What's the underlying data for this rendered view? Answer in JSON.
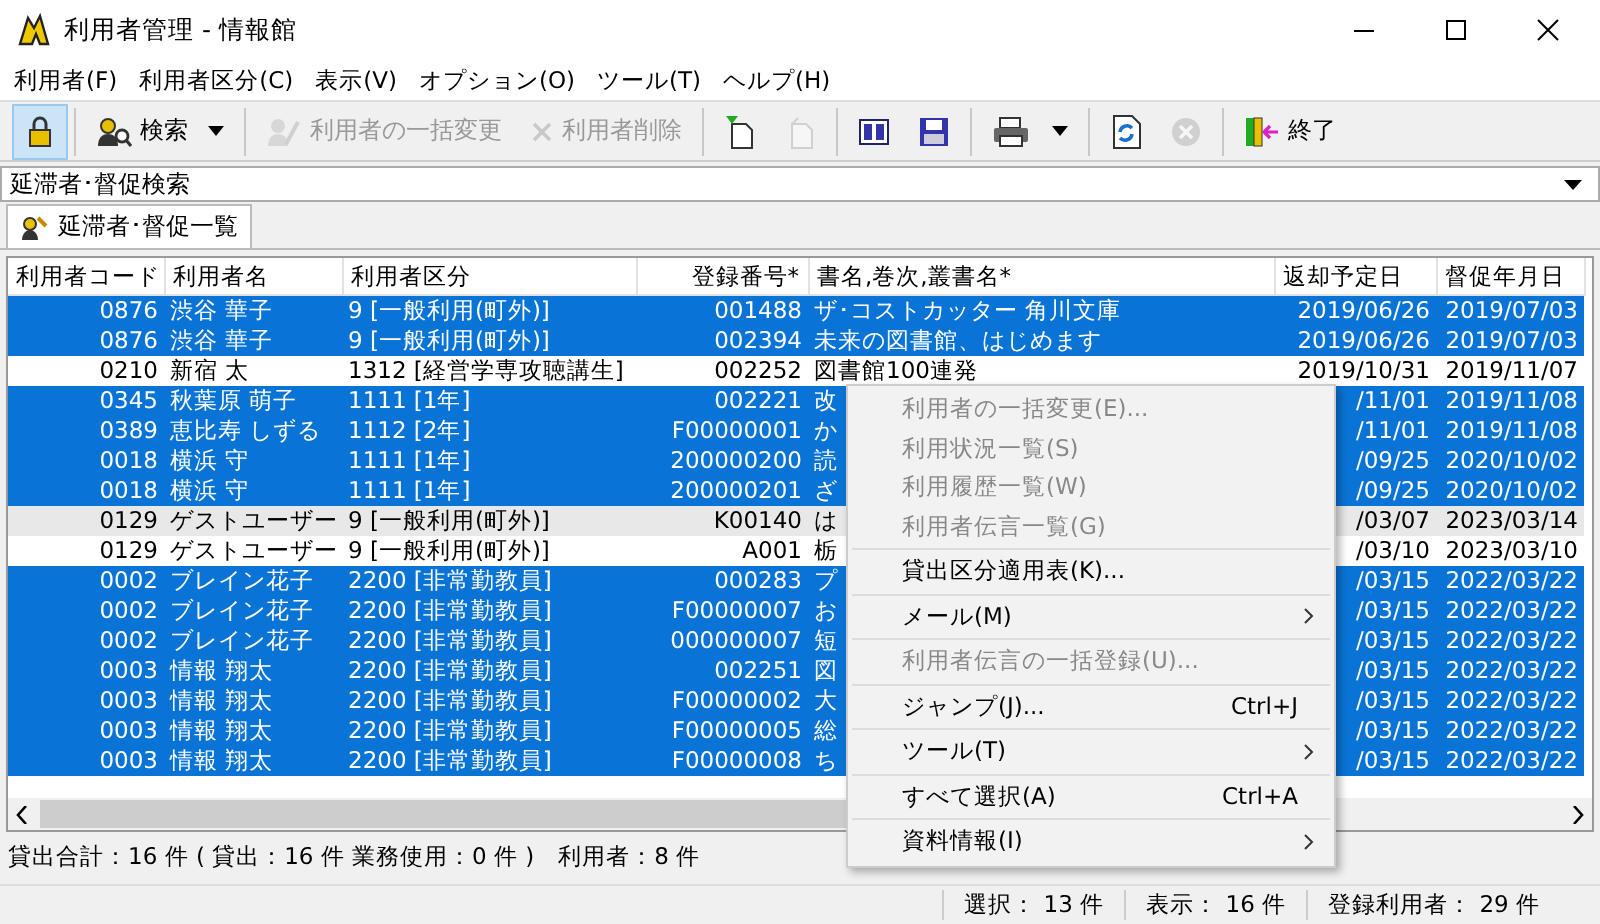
{
  "window": {
    "title": "利用者管理 - 情報館"
  },
  "menu_bar": [
    "利用者(F)",
    "利用者区分(C)",
    "表示(V)",
    "オプション(O)",
    "ツール(T)",
    "ヘルプ(H)"
  ],
  "toolbar": [
    {
      "pressed": true,
      "disabled": false,
      "dropdown": false
    },
    {
      "label": "検索",
      "pressed": false,
      "disabled": false,
      "dropdown": true
    },
    {
      "label": "利用者の一括変更",
      "pressed": false,
      "disabled": true,
      "dropdown": false
    },
    {
      "label": "利用者削除",
      "pressed": false,
      "disabled": true,
      "dropdown": false
    },
    {
      "pressed": false,
      "disabled": false,
      "dropdown": false
    },
    {
      "pressed": false,
      "disabled": true,
      "dropdown": false
    },
    {
      "pressed": false,
      "disabled": false,
      "dropdown": false
    },
    {
      "pressed": false,
      "disabled": false,
      "dropdown": false
    },
    {
      "pressed": false,
      "disabled": false,
      "dropdown": true
    },
    {
      "pressed": false,
      "disabled": false,
      "dropdown": false
    },
    {
      "pressed": false,
      "disabled": true,
      "dropdown": false
    },
    {
      "label": "終了",
      "pressed": false,
      "disabled": false,
      "dropdown": false
    }
  ],
  "search_mode": {
    "value": "延滞者･督促検索"
  },
  "tabs": [
    {
      "label": "延滞者･督促一覧",
      "selected": true
    }
  ],
  "table": {
    "columns": [
      "利用者コード",
      "利用者名",
      "利用者区分",
      "登録番号*",
      "書名,巻次,叢書名*",
      "返却予定日",
      "督促年月日"
    ],
    "rows": [
      {
        "cells": [
          "0876",
          "渋谷 華子",
          "9 [一般利用(町外)]",
          "001488",
          "ザ･コストカッター 角川文庫",
          "2019/06/26",
          "2019/07/03"
        ],
        "selected": true,
        "current": false
      },
      {
        "cells": [
          "0876",
          "渋谷 華子",
          "9 [一般利用(町外)]",
          "002394",
          "未来の図書館、はじめます",
          "2019/06/26",
          "2019/07/03"
        ],
        "selected": true,
        "current": false
      },
      {
        "cells": [
          "0210",
          "新宿 太",
          "1312 [経営学専攻聴講生]",
          "002252",
          "図書館100連発",
          "2019/10/31",
          "2019/11/07"
        ],
        "selected": false,
        "current": false
      },
      {
        "cells": [
          "0345",
          "秋葉原 萌子",
          "1111 [1年]",
          "002221",
          "改",
          "/11/01",
          "2019/11/08"
        ],
        "selected": true,
        "current": false
      },
      {
        "cells": [
          "0389",
          "恵比寿 しずる",
          "1112 [2年]",
          "F00000001",
          "か",
          "/11/01",
          "2019/11/08"
        ],
        "selected": true,
        "current": false
      },
      {
        "cells": [
          "0018",
          "横浜 守",
          "1111 [1年]",
          "200000200",
          "読",
          "/09/25",
          "2020/10/02"
        ],
        "selected": true,
        "current": false
      },
      {
        "cells": [
          "0018",
          "横浜 守",
          "1111 [1年]",
          "200000201",
          "ざ",
          "/09/25",
          "2020/10/02"
        ],
        "selected": true,
        "current": false
      },
      {
        "cells": [
          "0129",
          "ゲストユーザー",
          "9 [一般利用(町外)]",
          "K00140",
          "は",
          "/03/07",
          "2023/03/14"
        ],
        "selected": false,
        "current": true
      },
      {
        "cells": [
          "0129",
          "ゲストユーザー",
          "9 [一般利用(町外)]",
          "A001",
          "栃",
          "/03/10",
          "2023/03/10"
        ],
        "selected": false,
        "current": false
      },
      {
        "cells": [
          "0002",
          "ブレイン花子",
          "2200 [非常勤教員]",
          "000283",
          "プ",
          "/03/15",
          "2022/03/22"
        ],
        "selected": true,
        "current": false
      },
      {
        "cells": [
          "0002",
          "ブレイン花子",
          "2200 [非常勤教員]",
          "F00000007",
          "お",
          "/03/15",
          "2022/03/22"
        ],
        "selected": true,
        "current": false
      },
      {
        "cells": [
          "0002",
          "ブレイン花子",
          "2200 [非常勤教員]",
          "000000007",
          "短",
          "/03/15",
          "2022/03/22"
        ],
        "selected": true,
        "current": false
      },
      {
        "cells": [
          "0003",
          "情報 翔太",
          "2200 [非常勤教員]",
          "002251",
          "図",
          "/03/15",
          "2022/03/22"
        ],
        "selected": true,
        "current": false
      },
      {
        "cells": [
          "0003",
          "情報 翔太",
          "2200 [非常勤教員]",
          "F00000002",
          "大",
          "/03/15",
          "2022/03/22"
        ],
        "selected": true,
        "current": false
      },
      {
        "cells": [
          "0003",
          "情報 翔太",
          "2200 [非常勤教員]",
          "F00000005",
          "総",
          "/03/15",
          "2022/03/22"
        ],
        "selected": true,
        "current": false
      },
      {
        "cells": [
          "0003",
          "情報 翔太",
          "2200 [非常勤教員]",
          "F00000008",
          "ち",
          "/03/15",
          "2022/03/22"
        ],
        "selected": true,
        "current": false
      }
    ]
  },
  "context_menu": [
    {
      "kind": "item",
      "label": "利用者の一括変更(E)...",
      "disabled": true,
      "submenu": false
    },
    {
      "kind": "item",
      "label": "利用状況一覧(S)",
      "disabled": true,
      "submenu": false
    },
    {
      "kind": "item",
      "label": "利用履歴一覧(W)",
      "disabled": true,
      "submenu": false
    },
    {
      "kind": "item",
      "label": "利用者伝言一覧(G)",
      "disabled": true,
      "submenu": false
    },
    {
      "kind": "separator"
    },
    {
      "kind": "item",
      "label": "貸出区分適用表(K)...",
      "disabled": false,
      "submenu": false
    },
    {
      "kind": "separator"
    },
    {
      "kind": "item",
      "label": "メール(M)",
      "disabled": false,
      "submenu": true
    },
    {
      "kind": "separator"
    },
    {
      "kind": "item",
      "label": "利用者伝言の一括登録(U)...",
      "disabled": true,
      "submenu": false
    },
    {
      "kind": "separator"
    },
    {
      "kind": "item",
      "label": "ジャンプ(J)...",
      "shortcut": "Ctrl+J",
      "disabled": false,
      "submenu": false
    },
    {
      "kind": "separator"
    },
    {
      "kind": "item",
      "label": "ツール(T)",
      "disabled": false,
      "submenu": true
    },
    {
      "kind": "separator"
    },
    {
      "kind": "item",
      "label": "すべて選択(A)",
      "shortcut": "Ctrl+A",
      "disabled": false,
      "submenu": false
    },
    {
      "kind": "separator"
    },
    {
      "kind": "item",
      "label": "資料情報(I)",
      "disabled": false,
      "submenu": true
    }
  ],
  "summary": "貸出合計：16 件 ( 貸出：16 件 業務使用：0 件 )　利用者：8 件",
  "status_bar": [
    "選択： 13 件",
    "表示： 16 件",
    "登録利用者： 29 件"
  ]
}
